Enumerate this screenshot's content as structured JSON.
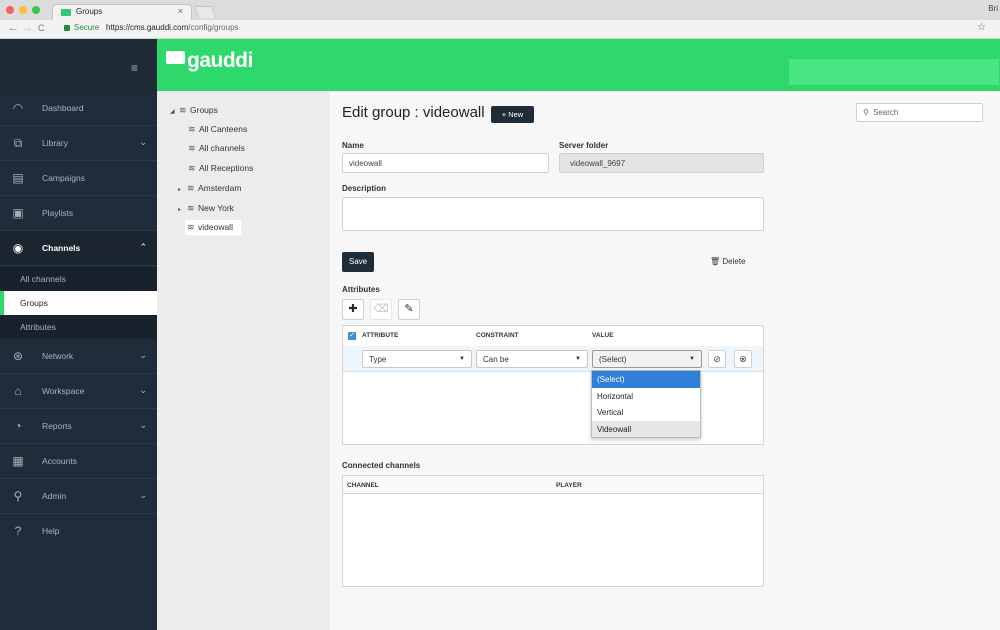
{
  "browser": {
    "tab_title": "Groups",
    "tab_close": "×",
    "profile": "Bri",
    "secure": "Secure",
    "url_base": "https://cms.gauddi.com",
    "url_path": "/config/groups",
    "back": "←",
    "forward": "→",
    "reload": "C",
    "star": "☆"
  },
  "brand": {
    "name": "gauddi",
    "hamburger": "≡"
  },
  "sidebar": {
    "dashboard": "Dashboard",
    "library": "Library",
    "campaigns": "Campaigns",
    "playlists": "Playlists",
    "channels": "Channels",
    "all_channels": "All channels",
    "groups": "Groups",
    "attributes": "Attributes",
    "network": "Network",
    "workspace": "Workspace",
    "reports": "Reports",
    "accounts": "Accounts",
    "admin": "Admin",
    "help": "Help"
  },
  "tree": {
    "root": "Groups",
    "all_canteens": "All Canteens",
    "all_channels": "All channels",
    "all_receptions": "All Receptions",
    "amsterdam": "Amsterdam",
    "new_york": "New York",
    "videowall": "videowall"
  },
  "main": {
    "title": "Edit group : videowall",
    "new_button": "New",
    "search_placeholder": "Search",
    "name_label": "Name",
    "name_value": "videowall",
    "server_folder_label": "Server folder",
    "server_folder_value": "videowall_9697",
    "description_label": "Description",
    "save_button": "Save",
    "delete_link": "Delete",
    "attributes_label": "Attributes",
    "col_attribute": "ATTRIBUTE",
    "col_constraint": "CONSTRAINT",
    "col_value": "VALUE",
    "row": {
      "attribute": "Type",
      "constraint": "Can be",
      "value": "(Select)"
    },
    "dropdown_options": [
      "(Select)",
      "Horizontal",
      "Vertical",
      "Videowall"
    ],
    "connected_label": "Connected channels",
    "col_channel": "CHANNEL",
    "col_player": "PLAYER"
  },
  "colors": {
    "brand_green": "#2fd86b",
    "sidebar_dark": "#1f2d3b",
    "highlight_blue": "#2f7ed8"
  }
}
